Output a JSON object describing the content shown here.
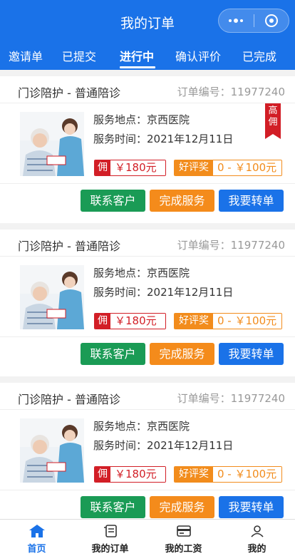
{
  "header": {
    "title": "我的订单",
    "capsule_icons": [
      "more-dots-icon",
      "target-circle-icon"
    ],
    "accent_color": "#1a72e8"
  },
  "tabs": [
    {
      "label": "邀请单",
      "active": false
    },
    {
      "label": "已提交",
      "active": false
    },
    {
      "label": "进行中",
      "active": true
    },
    {
      "label": "确认评价",
      "active": false
    },
    {
      "label": "已完成",
      "active": false
    }
  ],
  "orders": [
    {
      "service": "门诊陪护 - 普通陪诊",
      "order_no": "订单编号：11977240",
      "location": "服务地点：京西医院",
      "time": "服务时间：2021年12月11日",
      "high_badge": "高佣",
      "commission_label": "佣",
      "commission_value": "￥180元",
      "reward_label": "好评奖",
      "reward_value": "0 - ￥100元",
      "buttons": {
        "contact": "联系客户",
        "finish": "完成服务",
        "transfer": "我要转单"
      }
    },
    {
      "service": "门诊陪护 - 普通陪诊",
      "order_no": "订单编号：11977240",
      "location": "服务地点：京西医院",
      "time": "服务时间：2021年12月11日",
      "commission_label": "佣",
      "commission_value": "￥180元",
      "reward_label": "好评奖",
      "reward_value": "0 - ￥100元",
      "buttons": {
        "contact": "联系客户",
        "finish": "完成服务",
        "transfer": "我要转单"
      }
    },
    {
      "service": "门诊陪护 - 普通陪诊",
      "order_no": "订单编号：11977240",
      "location": "服务地点：京西医院",
      "time": "服务时间：2021年12月11日",
      "commission_label": "佣",
      "commission_value": "￥180元",
      "reward_label": "好评奖",
      "reward_value": "0 - ￥100元",
      "buttons": {
        "contact": "联系客户",
        "finish": "完成服务",
        "transfer": "我要转单"
      }
    }
  ],
  "bottom_nav": [
    {
      "label": "首页",
      "icon": "home-icon",
      "active": true
    },
    {
      "label": "我的订单",
      "icon": "order-icon",
      "active": false
    },
    {
      "label": "我的工资",
      "icon": "wallet-icon",
      "active": false
    },
    {
      "label": "我的",
      "icon": "user-icon",
      "active": false
    }
  ]
}
